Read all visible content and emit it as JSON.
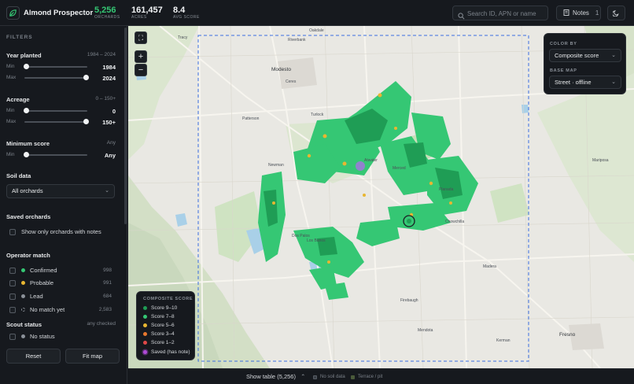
{
  "header": {
    "app_title": "Almond Prospector",
    "stats": [
      {
        "value": "5,256",
        "label": "ORCHARDS"
      },
      {
        "value": "161,457",
        "label": "ACRES"
      },
      {
        "value": "8.4",
        "label": "AVG SCORE"
      }
    ],
    "search_placeholder": "Search ID, APN or name",
    "notes_label": "Notes",
    "notes_count": "1"
  },
  "sidebar": {
    "filters_title": "FILTERS",
    "year_planted": {
      "label": "Year planted",
      "range": "1984 – 2024",
      "min_label": "Min",
      "min_value": "1984",
      "max_label": "Max",
      "max_value": "2024"
    },
    "acreage": {
      "label": "Acreage",
      "range": "0 – 150+",
      "min_label": "Min",
      "min_value": "0",
      "max_label": "Max",
      "max_value": "150+"
    },
    "min_score": {
      "label": "Minimum score",
      "range": "Any",
      "min_label": "Min",
      "value": "Any"
    },
    "soil_data": {
      "label": "Soil data",
      "selected": "All orchards"
    },
    "saved_orchards": {
      "label": "Saved orchards",
      "checkbox_label": "Show only orchards with notes"
    },
    "operator_match": {
      "label": "Operator match",
      "items": [
        {
          "label": "Confirmed",
          "count": "998",
          "color": "#35c774"
        },
        {
          "label": "Probable",
          "count": "991",
          "color": "#e8b631"
        },
        {
          "label": "Lead",
          "count": "684",
          "color": "#8a9098"
        },
        {
          "label": "No match yet",
          "count": "2,583",
          "color": "none"
        }
      ]
    },
    "scout_status": {
      "label": "Scout status",
      "hint": "any checked",
      "items": [
        {
          "label": "No status",
          "color": "#8a9098"
        }
      ]
    },
    "reset_label": "Reset",
    "fit_map_label": "Fit map"
  },
  "map": {
    "color_by": {
      "title": "COLOR BY",
      "selected": "Composite score"
    },
    "base_map": {
      "title": "BASE MAP",
      "selected": "Street · offline"
    },
    "legend": {
      "title": "COMPOSITE SCORE",
      "items": [
        {
          "label": "Score 9–10",
          "color": "#1f9d55"
        },
        {
          "label": "Score 7–8",
          "color": "#35c774"
        },
        {
          "label": "Score 5–6",
          "color": "#e8b631"
        },
        {
          "label": "Score 3–4",
          "color": "#e8782e"
        },
        {
          "label": "Score 1–2",
          "color": "#e04848"
        },
        {
          "label": "Saved (has note)",
          "color": "#b04ad8"
        }
      ]
    },
    "places": [
      {
        "name": "Oakdale"
      },
      {
        "name": "Tracy"
      },
      {
        "name": "Riverbank"
      },
      {
        "name": "Modesto"
      },
      {
        "name": "Ceres"
      },
      {
        "name": "Turlock"
      },
      {
        "name": "Patterson"
      },
      {
        "name": "Newman"
      },
      {
        "name": "Merced"
      },
      {
        "name": "Atwater"
      },
      {
        "name": "Los Banos"
      },
      {
        "name": "Chowchilla"
      },
      {
        "name": "Madera"
      },
      {
        "name": "Firebaugh"
      },
      {
        "name": "Mendota"
      },
      {
        "name": "Kerman"
      },
      {
        "name": "Fresno"
      },
      {
        "name": "Dos Palos"
      },
      {
        "name": "Planada"
      },
      {
        "name": "Mariposa"
      }
    ]
  },
  "bottom_bar": {
    "show_table_label": "Show table (5,256)",
    "legend_items": [
      {
        "label": "No soil data",
        "color": "#3a3f46"
      },
      {
        "label": "Terrace / pit",
        "color": "#4a5a3a"
      }
    ]
  }
}
